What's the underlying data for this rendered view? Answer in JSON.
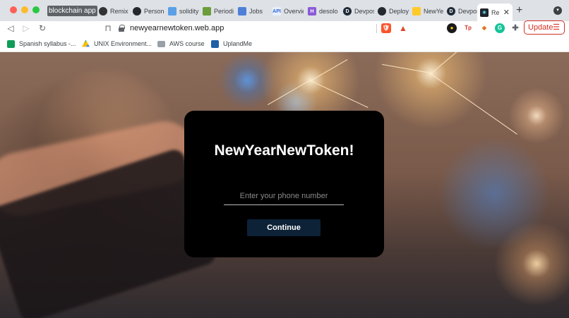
{
  "browser": {
    "tab_group_label": "blockchain app",
    "tabs": [
      {
        "title": "Remix",
        "icon": "remix-icon"
      },
      {
        "title": "Personal",
        "icon": "github-icon"
      },
      {
        "title": "solidity",
        "icon": "stackoverflow-icon"
      },
      {
        "title": "Periodic",
        "icon": "periodic-icon"
      },
      {
        "title": "Jobs",
        "icon": "jobs-icon"
      },
      {
        "title": "Overview",
        "icon": "api-icon"
      },
      {
        "title": "desolo",
        "icon": "hashnode-icon"
      },
      {
        "title": "Devpost",
        "icon": "devpost-icon"
      },
      {
        "title": "Deploy",
        "icon": "github-icon"
      },
      {
        "title": "NewYear",
        "icon": "firebase-icon"
      },
      {
        "title": "Devpost",
        "icon": "devpost-icon"
      },
      {
        "title": "Re",
        "icon": "react-icon",
        "active": true
      }
    ],
    "url": "newyearnewtoken.web.app",
    "update_label": "Update",
    "bookmarks": [
      {
        "label": "Spanish syllabus -...",
        "icon": "google-sheets-icon"
      },
      {
        "label": "UNIX Environment...",
        "icon": "google-drive-icon"
      },
      {
        "label": "AWS course",
        "icon": "folder-icon"
      },
      {
        "label": "UplandMe",
        "icon": "upland-icon"
      }
    ]
  },
  "page": {
    "title": "NewYearNewToken!",
    "phone_placeholder": "Enter your phone number",
    "phone_value": "",
    "continue_label": "Continue"
  },
  "colors": {
    "card_bg": "#000000",
    "button_bg": "#0d2237",
    "update_red": "#d93025"
  }
}
